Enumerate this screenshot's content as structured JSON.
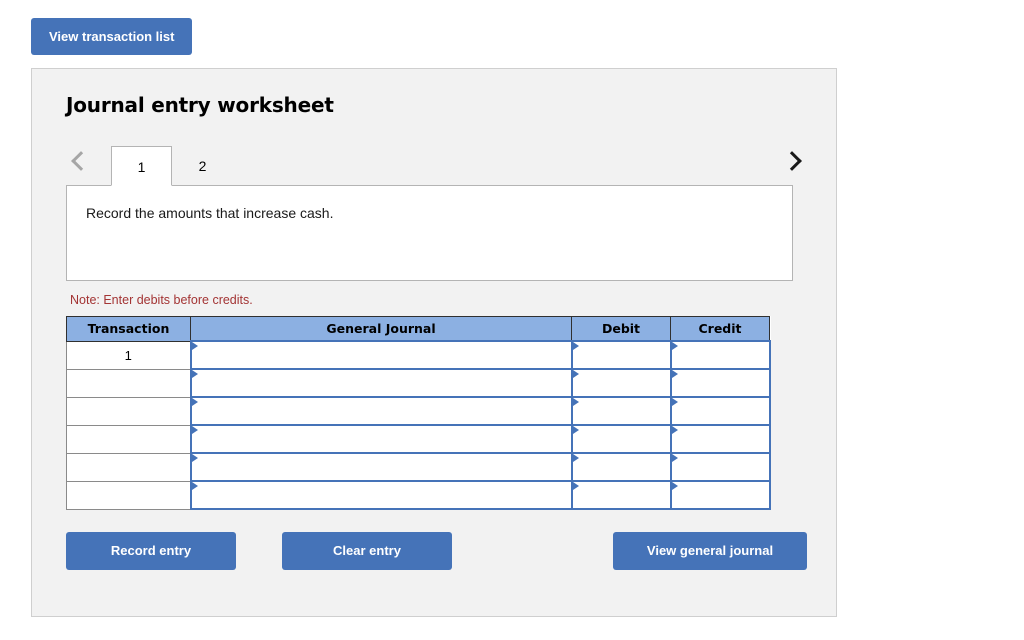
{
  "top": {
    "view_transaction_list_label": "View transaction list"
  },
  "panel": {
    "title": "Journal entry worksheet",
    "nav": {
      "prev_icon": "chevron-left-icon",
      "next_icon": "chevron-right-icon"
    },
    "tabs": [
      {
        "label": "1",
        "active": true
      },
      {
        "label": "2",
        "active": false
      }
    ],
    "instruction": "Record the amounts that increase cash.",
    "note": "Note: Enter debits before credits.",
    "note_color": "#a33434",
    "table": {
      "headers": [
        "Transaction",
        "General Journal",
        "Debit",
        "Credit"
      ],
      "rows": [
        {
          "transaction": "1",
          "general_journal": "",
          "debit": "",
          "credit": ""
        },
        {
          "transaction": "",
          "general_journal": "",
          "debit": "",
          "credit": ""
        },
        {
          "transaction": "",
          "general_journal": "",
          "debit": "",
          "credit": ""
        },
        {
          "transaction": "",
          "general_journal": "",
          "debit": "",
          "credit": ""
        },
        {
          "transaction": "",
          "general_journal": "",
          "debit": "",
          "credit": ""
        },
        {
          "transaction": "",
          "general_journal": "",
          "debit": "",
          "credit": ""
        }
      ],
      "header_bg": "#8cb0e2",
      "cell_border": "#4573b8"
    },
    "footer": {
      "record_entry_label": "Record entry",
      "clear_entry_label": "Clear entry",
      "view_general_journal_label": "View general journal"
    }
  },
  "theme": {
    "button_blue": "#4573b8",
    "panel_bg": "#f2f2f2"
  }
}
